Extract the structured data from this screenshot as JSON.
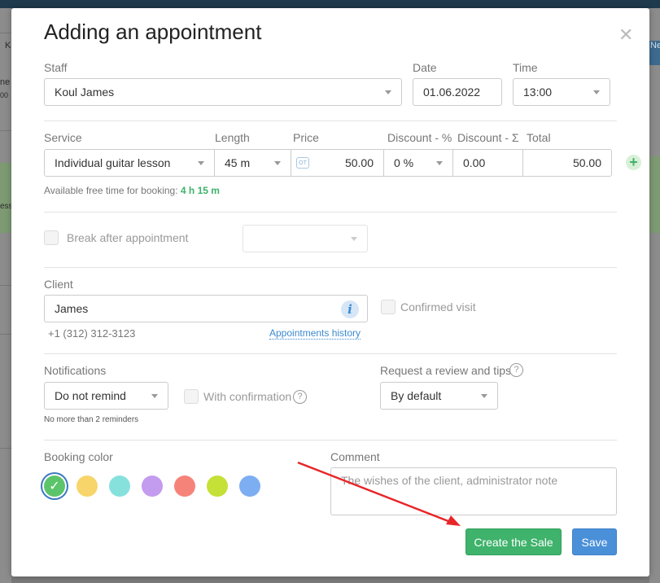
{
  "modal": {
    "title": "Adding an appointment"
  },
  "staff": {
    "label": "Staff",
    "value": "Koul James"
  },
  "date": {
    "label": "Date",
    "value": "01.06.2022"
  },
  "time": {
    "label": "Time",
    "value": "13:00"
  },
  "service_row": {
    "headers": {
      "service": "Service",
      "length": "Length",
      "price": "Price",
      "discount_pct": "Discount - %",
      "discount_sum": "Discount - Σ",
      "total": "Total"
    },
    "service": "Individual guitar lesson",
    "length": "45 m",
    "price_badge": "OT",
    "price": "50.00",
    "discount_pct": "0 %",
    "discount_sum": "0.00",
    "total": "50.00"
  },
  "free_time": {
    "label": "Available free time for booking:",
    "value": "4 h 15 m"
  },
  "break_after": {
    "label": "Break after appointment"
  },
  "client": {
    "label": "Client",
    "name": "James",
    "phone": "+1 (312) 312-3123",
    "history_link": "Appointments history",
    "confirmed_label": "Confirmed visit"
  },
  "notifications": {
    "label": "Notifications",
    "value": "Do not remind",
    "with_confirmation": "With confirmation",
    "note": "No more than 2 reminders"
  },
  "review": {
    "label": "Request a review and tips",
    "value": "By default"
  },
  "booking_color": {
    "label": "Booking color",
    "colors": [
      "#5cc46a",
      "#f7d56b",
      "#86e1dd",
      "#c39cef",
      "#f6837a",
      "#c5e036",
      "#7eaef2"
    ],
    "selected": 0
  },
  "comment": {
    "label": "Comment",
    "placeholder": "The wishes of the client, administrator note"
  },
  "buttons": {
    "create_sale": "Create the Sale",
    "save": "Save"
  },
  "background": {
    "left_text_1": "ne",
    "left_text_2": "00",
    "left_text_3": "ess",
    "top_text": "K",
    "right_text": "Ne"
  },
  "colors": {
    "accent_green": "#3fb26b",
    "accent_blue": "#4a90d9",
    "arrow_red": "#e8262a",
    "link": "#3d8ad1"
  }
}
